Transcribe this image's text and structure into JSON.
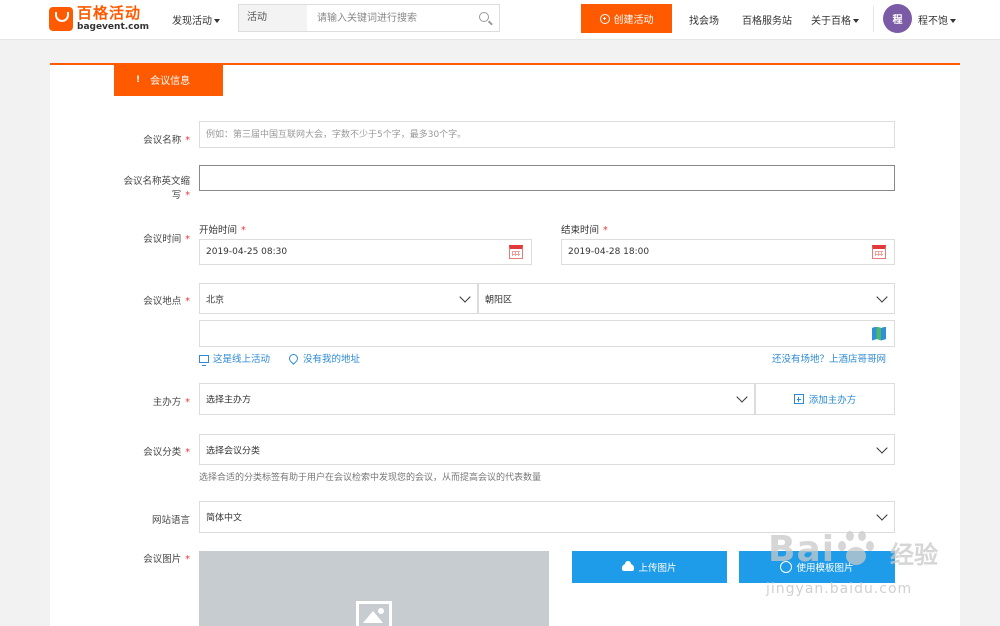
{
  "header": {
    "logo_cn": "百格活动",
    "logo_en": "bagevent.com",
    "discover": "发现活动",
    "search": {
      "category": "活动",
      "placeholder": "请输入关键词进行搜索"
    },
    "create_button": "创建活动",
    "nav": {
      "venue": "找会场",
      "service": "百格服务站",
      "about": "关于百格"
    },
    "user": {
      "avatar": "程",
      "name": "程不饱"
    }
  },
  "form": {
    "section_title": "会议信息",
    "name": {
      "label": "会议名称",
      "placeholder": "例如：第三届中国互联网大会，字数不少于5个字，最多30个字。",
      "value": ""
    },
    "en_abbr": {
      "label_line1": "会议名称英文缩",
      "label_line2": "写",
      "value": ""
    },
    "time": {
      "label": "会议时间",
      "start_label": "开始时间",
      "start_value": "2019-04-25 08:30",
      "end_label": "结束时间",
      "end_value": "2019-04-28 18:00"
    },
    "location": {
      "label": "会议地点",
      "city": "北京",
      "district": "朝阳区",
      "address": "",
      "online_link": "这是线上活动",
      "no_address_link": "没有我的地址",
      "venue_link": "还没有场地？上酒店哥哥网"
    },
    "organizer": {
      "label": "主办方",
      "select": "选择主办方",
      "add_button": "添加主办方"
    },
    "category": {
      "label": "会议分类",
      "select": "选择会议分类",
      "hint": "选择合适的分类标签有助于用户在会议检索中发现您的会议，从而提高会议的代表数量"
    },
    "language": {
      "label": "网站语言",
      "select": "简体中文"
    },
    "image": {
      "label": "会议图片",
      "upload_button": "上传图片",
      "second_button": "使用模板图片"
    },
    "required_mark": "*"
  },
  "watermark": {
    "brand": "Bai",
    "suffix": "经验",
    "url": "jingyan.baidu.com"
  }
}
